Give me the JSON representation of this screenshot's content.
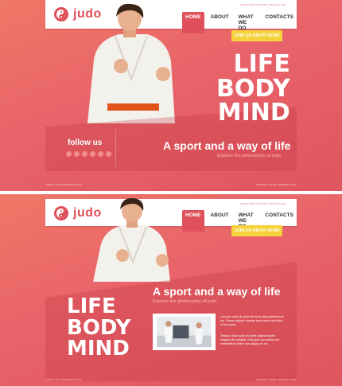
{
  "brand": {
    "name": "judo"
  },
  "header": {
    "tiny_links": "SIGN IN  |  MY ACCOUNT  |  SIGN UP  |  FAQ"
  },
  "nav": [
    "HOME",
    "ABOUT",
    "WHAT WE DO",
    "CONTACTS"
  ],
  "cta": "JOIN US RIGHT NOW!",
  "hero": {
    "headline_words": [
      "LIFE",
      "BODY",
      "MIND"
    ],
    "slogan": "A sport and a way of life",
    "slogan_sub": "Explore the philosophy of judo"
  },
  "social": {
    "title": "follow us",
    "icons": [
      "facebook-icon",
      "google-icon",
      "pinterest-icon",
      "skype-icon",
      "linkedin-icon",
      "rss-icon"
    ]
  },
  "footer": {
    "left": "JUDO © 2013 • PRIVACY POLICY",
    "right": "SUPPORT  |  FAQS  |  SITEMAP  |  HELP"
  },
  "content": {
    "para1": "Loboda nulla sit amet elit ra tis ulequateria dunt tus. Donec aliquet nostras lexp lorem tod dolor sit at conse.",
    "para2": "Tempor dolor wasi sit amet adipiscing elit magna nib volutpat. Sed quia nonummy sed exercitation tation nos aliquip ex ea."
  },
  "colors": {
    "accent": "#e0505a",
    "cta": "#f5d23a",
    "background": "#e8636a"
  }
}
